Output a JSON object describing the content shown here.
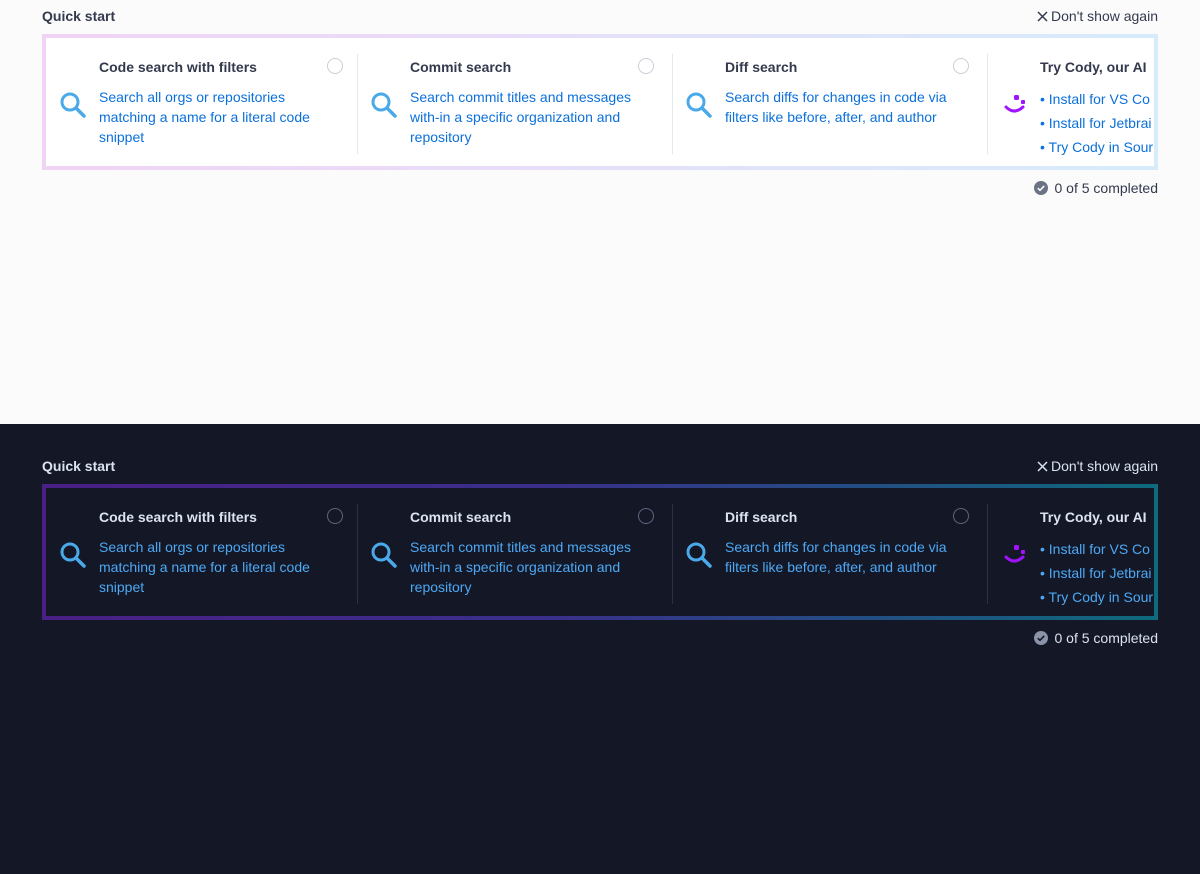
{
  "quick_start": {
    "title": "Quick start",
    "dismiss_label": "Don't show again",
    "cards": [
      {
        "title": "Code search with filters",
        "description": "Search all orgs or repositories matching a name for a literal code snippet",
        "icon": "search-icon"
      },
      {
        "title": "Commit search",
        "description": "Search commit titles and messages with-in a specific organization and repository",
        "icon": "search-icon"
      },
      {
        "title": "Diff search",
        "description": "Search diffs for changes in code via filters like before, after, and author",
        "icon": "search-icon"
      },
      {
        "title": "Try Cody, our AI",
        "icon": "cody-icon",
        "links": [
          "• Install for VS Co",
          "• Install for Jetbrai",
          "• Try Cody in Sour"
        ]
      }
    ],
    "progress_text": "0 of 5 completed",
    "progress_completed": 0,
    "progress_total": 5
  },
  "colors": {
    "light_background": "#fbfbfc",
    "dark_background": "#141826",
    "link_light": "#0b70db",
    "link_dark": "#4da8f5",
    "search_icon": "#4aa9e9",
    "cody_icon": "#a112ff"
  }
}
